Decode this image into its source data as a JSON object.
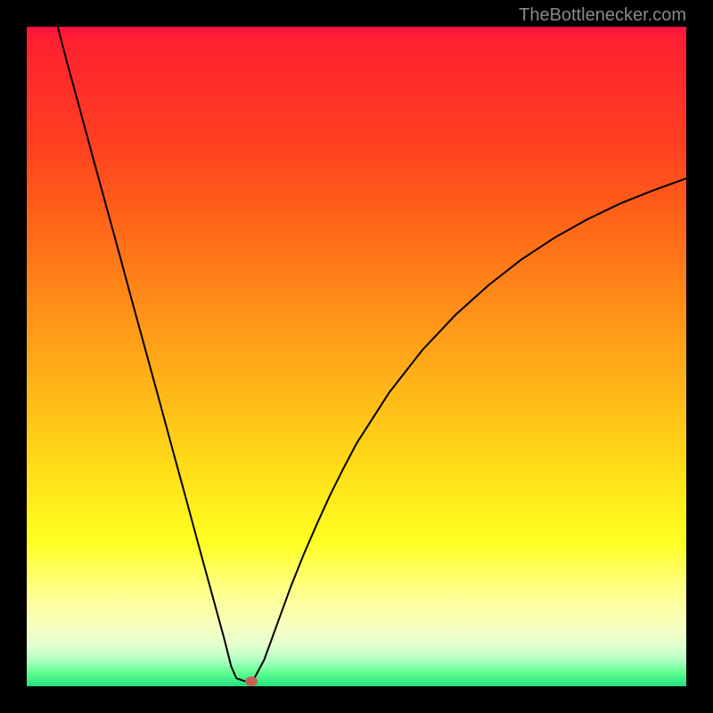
{
  "attribution": "TheBottlenecker.com",
  "colors": {
    "frame": "#000000",
    "curve": "#000000",
    "dot": "#c56050"
  },
  "chart_data": {
    "type": "line",
    "title": "",
    "xlabel": "",
    "ylabel": "",
    "xlim": [
      0,
      100
    ],
    "ylim": [
      0,
      100
    ],
    "x": [
      4.7,
      6,
      8,
      10,
      12,
      14,
      16,
      18,
      20,
      22,
      24,
      26,
      28,
      30,
      31,
      31.8,
      33,
      33.8,
      34.5,
      36,
      38,
      40,
      42,
      44,
      46,
      48,
      50,
      55,
      60,
      65,
      70,
      75,
      80,
      85,
      90,
      95,
      100
    ],
    "values": [
      100,
      95,
      87.7,
      80.3,
      73,
      65.7,
      58.3,
      51,
      43.7,
      36.3,
      29,
      21.6,
      14.3,
      7,
      3,
      1.2,
      0.8,
      0.8,
      1.2,
      4,
      9.5,
      15,
      20,
      24.6,
      29,
      33,
      36.8,
      44.6,
      51,
      56.3,
      60.8,
      64.7,
      68,
      70.8,
      73.2,
      75.2,
      77
    ],
    "marker": {
      "x": 34,
      "y": 0.8
    },
    "grid": false,
    "legend": false
  }
}
